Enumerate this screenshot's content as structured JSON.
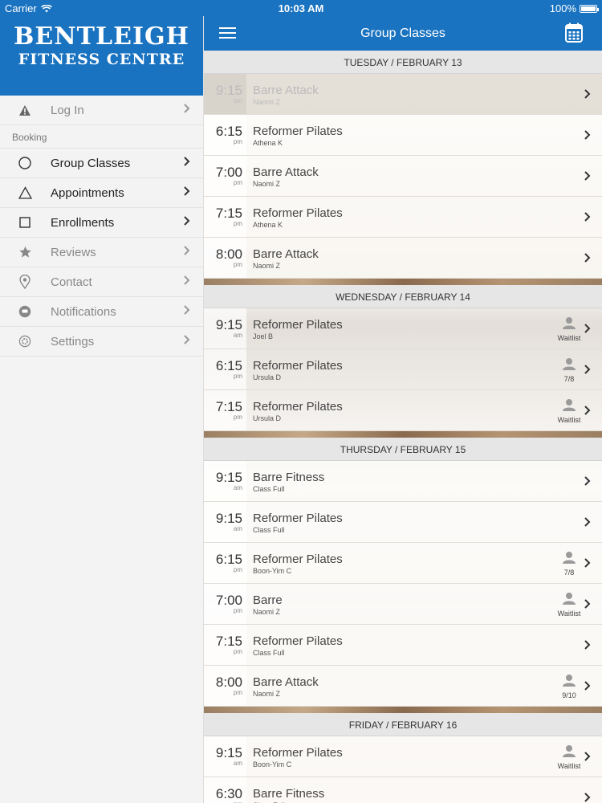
{
  "status_bar": {
    "carrier": "Carrier",
    "time": "10:03 AM",
    "battery": "100%"
  },
  "brand": {
    "line1": "BENTLEIGH",
    "line2": "FITNESS CENTRE"
  },
  "sidebar": {
    "login": {
      "label": "Log In",
      "icon": "warning-icon"
    },
    "section": "Booking",
    "items": [
      {
        "label": "Group Classes",
        "icon": "circle-icon",
        "enabled": true
      },
      {
        "label": "Appointments",
        "icon": "triangle-icon",
        "enabled": true
      },
      {
        "label": "Enrollments",
        "icon": "square-icon",
        "enabled": true
      },
      {
        "label": "Reviews",
        "icon": "star-icon",
        "enabled": false
      },
      {
        "label": "Contact",
        "icon": "location-pin-icon",
        "enabled": false
      },
      {
        "label": "Notifications",
        "icon": "chat-bubble-icon",
        "enabled": false
      },
      {
        "label": "Settings",
        "icon": "gear-icon",
        "enabled": false
      }
    ]
  },
  "header": {
    "title": "Group Classes"
  },
  "days": [
    {
      "label": "TUESDAY / FEBRUARY 13",
      "classes": [
        {
          "time": "9:15",
          "ampm": "am",
          "name": "Barre Attack",
          "instructor": "Naomi Z"
        },
        {
          "time": "6:15",
          "ampm": "pm",
          "name": "Reformer Pilates",
          "instructor": "Athena K"
        },
        {
          "time": "7:00",
          "ampm": "pm",
          "name": "Barre Attack",
          "instructor": "Naomi Z"
        },
        {
          "time": "7:15",
          "ampm": "pm",
          "name": "Reformer Pilates",
          "instructor": "Athena K"
        },
        {
          "time": "8:00",
          "ampm": "pm",
          "name": "Barre Attack",
          "instructor": "Naomi Z"
        }
      ]
    },
    {
      "label": "WEDNESDAY / FEBRUARY 14",
      "classes": [
        {
          "time": "9:15",
          "ampm": "am",
          "name": "Reformer Pilates",
          "instructor": "Joel B",
          "badge": "Waitlist"
        },
        {
          "time": "6:15",
          "ampm": "pm",
          "name": "Reformer Pilates",
          "instructor": "Ursula D",
          "badge": "7/8"
        },
        {
          "time": "7:15",
          "ampm": "pm",
          "name": "Reformer Pilates",
          "instructor": "Ursula D",
          "badge": "Waitlist"
        }
      ]
    },
    {
      "label": "THURSDAY / FEBRUARY 15",
      "classes": [
        {
          "time": "9:15",
          "ampm": "am",
          "name": "Barre Fitness",
          "instructor": "Class Full"
        },
        {
          "time": "9:15",
          "ampm": "am",
          "name": "Reformer Pilates",
          "instructor": "Class Full"
        },
        {
          "time": "6:15",
          "ampm": "pm",
          "name": "Reformer Pilates",
          "instructor": "Boon-Yim C",
          "badge": "7/8"
        },
        {
          "time": "7:00",
          "ampm": "pm",
          "name": "Barre",
          "instructor": "Naomi Z",
          "badge": "Waitlist"
        },
        {
          "time": "7:15",
          "ampm": "pm",
          "name": "Reformer Pilates",
          "instructor": "Class Full"
        },
        {
          "time": "8:00",
          "ampm": "pm",
          "name": "Barre Attack",
          "instructor": "Naomi Z",
          "badge": "9/10"
        }
      ]
    },
    {
      "label": "FRIDAY / FEBRUARY 16",
      "classes": [
        {
          "time": "9:15",
          "ampm": "am",
          "name": "Reformer Pilates",
          "instructor": "Boon-Yim C",
          "badge": "Waitlist"
        },
        {
          "time": "6:30",
          "ampm": "pm",
          "name": "Barre Fitness",
          "instructor": "Class Full"
        }
      ]
    }
  ]
}
